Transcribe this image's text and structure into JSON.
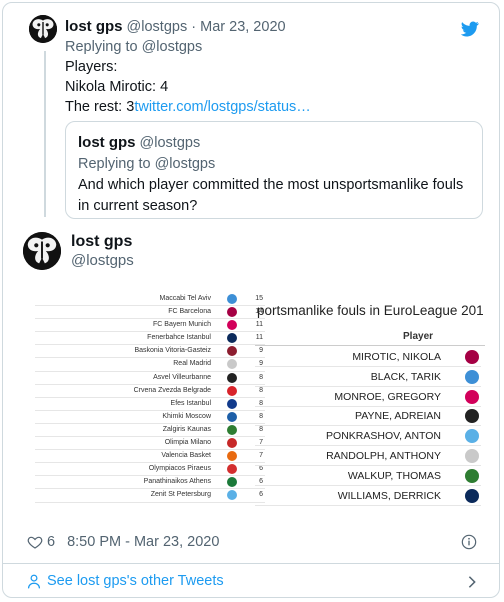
{
  "colors": {
    "accent": "#1d9bf0",
    "muted": "#536471",
    "border": "#cfd9de"
  },
  "reply_tweet": {
    "name": "lost gps",
    "handle": "@lostgps",
    "separator": "·",
    "date": "Mar 23, 2020",
    "replying_to": "Replying to @lostgps",
    "line1": "Players:",
    "line2": "Nikola Mirotic: 4",
    "line3_prefix": "The rest: ",
    "line3_number": "3",
    "line3_link": "twitter.com/lostgps/status…"
  },
  "quoted_tweet": {
    "name": "lost gps",
    "handle": "@lostgps",
    "replying_to": "Replying to @lostgps",
    "text": "And which player committed the most unsportsmanlike fouls in current season?"
  },
  "main_tweet": {
    "name": "lost gps",
    "handle": "@lostgps",
    "likes": "6",
    "timestamp": "8:50 PM - Mar 23, 2020",
    "see_more": "See lost gps's other Tweets"
  },
  "image": {
    "left_table": [
      {
        "team": "Maccabi Tel Aviv",
        "count": "15",
        "color": "#3d8fd6"
      },
      {
        "team": "FC Barcelona",
        "count": "14",
        "color": "#a50044"
      },
      {
        "team": "FC Bayern Munich",
        "count": "11",
        "color": "#d2005a"
      },
      {
        "team": "Fenerbahce Istanbul",
        "count": "11",
        "color": "#0b2a5b"
      },
      {
        "team": "Baskonia Vitoria-Gasteiz",
        "count": "9",
        "color": "#8c1d2f"
      },
      {
        "team": "Real Madrid",
        "count": "9",
        "color": "#c9c9c9"
      },
      {
        "team": "Asvel Villeurbanne",
        "count": "8",
        "color": "#222222"
      },
      {
        "team": "Crvena Zvezda Belgrade",
        "count": "8",
        "color": "#d8232a"
      },
      {
        "team": "Efes Istanbul",
        "count": "8",
        "color": "#123b8c"
      },
      {
        "team": "Khimki Moscow",
        "count": "8",
        "color": "#1d5fa8"
      },
      {
        "team": "Zalgiris Kaunas",
        "count": "8",
        "color": "#2e7d32"
      },
      {
        "team": "Olimpia Milano",
        "count": "7",
        "color": "#c62828"
      },
      {
        "team": "Valencia Basket",
        "count": "7",
        "color": "#e86a10"
      },
      {
        "team": "Olympiacos Piraeus",
        "count": "6",
        "color": "#d32f2f"
      },
      {
        "team": "Panathinaikos Athens",
        "count": "6",
        "color": "#1b7a3a"
      },
      {
        "team": "Zenit St Petersburg",
        "count": "6",
        "color": "#5ab0e6"
      }
    ],
    "right_title": "portsmanlike fouls in EuroLeague 201",
    "right_header": "Player",
    "right_table": [
      {
        "player": "MIROTIC, NIKOLA",
        "color": "#a50044"
      },
      {
        "player": "BLACK, TARIK",
        "color": "#3d8fd6"
      },
      {
        "player": "MONROE, GREGORY",
        "color": "#d2005a"
      },
      {
        "player": "PAYNE, ADREIAN",
        "color": "#222222"
      },
      {
        "player": "PONKRASHOV, ANTON",
        "color": "#5ab0e6"
      },
      {
        "player": "RANDOLPH, ANTHONY",
        "color": "#c9c9c9"
      },
      {
        "player": "WALKUP, THOMAS",
        "color": "#2e7d32"
      },
      {
        "player": "WILLIAMS, DERRICK",
        "color": "#0b2a5b"
      }
    ]
  }
}
